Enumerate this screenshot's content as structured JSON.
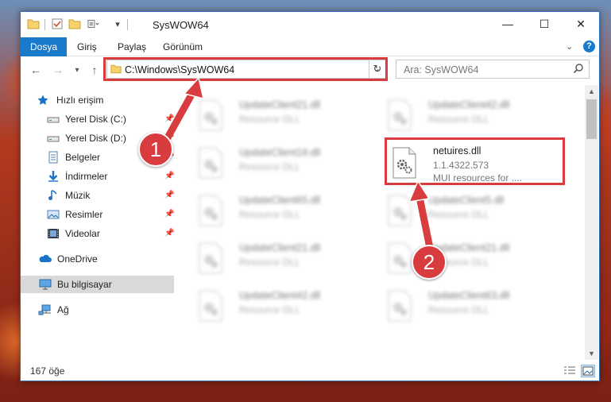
{
  "window": {
    "title": "SysWOW64",
    "controls": {
      "minimize": "—",
      "maximize": "☐",
      "close": "✕"
    }
  },
  "ribbon": {
    "tabs": [
      {
        "label": "Dosya",
        "active": true
      },
      {
        "label": "Giriş"
      },
      {
        "label": "Paylaş"
      },
      {
        "label": "Görünüm"
      }
    ],
    "help": "?"
  },
  "navigation": {
    "address": "C:\\Windows\\SysWOW64",
    "search_placeholder": "Ara: SysWOW64"
  },
  "sidebar": {
    "items": [
      {
        "label": "Hızlı erişim",
        "icon": "star-icon"
      },
      {
        "label": "Yerel Disk (C:)",
        "icon": "drive-icon",
        "pinned": true
      },
      {
        "label": "Yerel Disk (D:)",
        "icon": "drive-icon",
        "pinned": true
      },
      {
        "label": "Belgeler",
        "icon": "documents-icon",
        "pinned": true
      },
      {
        "label": "İndirmeler",
        "icon": "download-icon",
        "pinned": true
      },
      {
        "label": "Müzik",
        "icon": "music-icon",
        "pinned": true
      },
      {
        "label": "Resimler",
        "icon": "pictures-icon",
        "pinned": true
      },
      {
        "label": "Videolar",
        "icon": "videos-icon",
        "pinned": true
      },
      {
        "label": "OneDrive",
        "icon": "cloud-icon"
      },
      {
        "label": "Bu bilgisayar",
        "icon": "computer-icon",
        "selected": true
      },
      {
        "label": "Ağ",
        "icon": "network-icon"
      }
    ]
  },
  "files": [
    {
      "name": "UpdateClient21.dll",
      "desc": "Resource DLL"
    },
    {
      "name": "UpdateClient42.dll",
      "desc": "Resource DLL"
    },
    {
      "name": "UpdateClient19.dll",
      "desc": "Resource DLL"
    },
    {
      "name": "netuires.dll",
      "desc": "1.1.4322.573",
      "desc2": "MUI resources for ....",
      "focused": true
    },
    {
      "name": "UpdateClient65.dll",
      "desc": "Resource DLL"
    },
    {
      "name": "UpdateClient5.dll",
      "desc": "Resource DLL"
    },
    {
      "name": "UpdateClient21.dll",
      "desc": "Resource DLL"
    },
    {
      "name": "UpdateClient21.dll",
      "desc": "Resource DLL"
    },
    {
      "name": "UpdateClient42.dll",
      "desc": "Resource DLL"
    },
    {
      "name": "UpdateClient63.dll",
      "desc": "Resource DLL"
    }
  ],
  "status": {
    "item_count": "167 öğe"
  },
  "annotations": {
    "step1": "1",
    "step2": "2",
    "color": "#d93c3f"
  }
}
